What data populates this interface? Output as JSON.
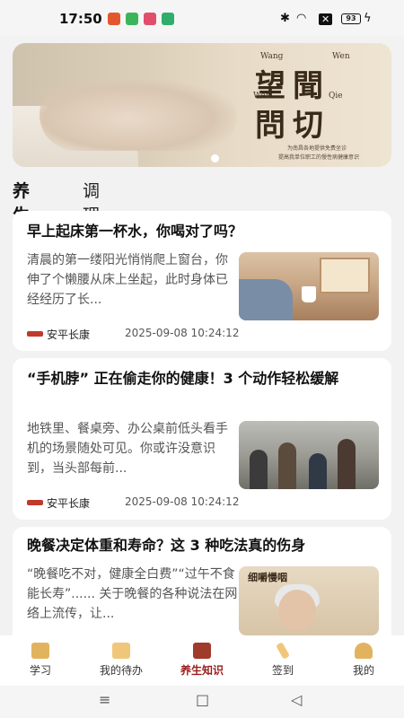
{
  "status_bar": {
    "time": "17:50",
    "battery": "93",
    "icons": [
      "app-red-icon",
      "app-green-icon",
      "app-pink-icon",
      "app-green2-icon",
      "bluetooth-icon",
      "wifi-icon",
      "notification-x-icon",
      "battery-icon",
      "charging-icon"
    ]
  },
  "banner": {
    "big_line1": "望聞",
    "big_line2": "問切",
    "pinyin_wang": "Wang",
    "pinyin_wen1": "Wen",
    "pinyin_wen2": "Wen",
    "pinyin_qie": "Qie",
    "subtitle_line1": "为南昌各地提供免费坐诊",
    "subtitle_line2": "提高我单位职工的慢性病健康意识",
    "page_indicator": "1"
  },
  "category_tabs": {
    "active": "养生",
    "inactive": "调理"
  },
  "articles": [
    {
      "title": "早上起床第一杯水，你喝对了吗？",
      "summary": "清晨的第一缕阳光悄悄爬上窗台，你伸了个懒腰从床上坐起，此时身体已经经历了长...",
      "source": "安平长康",
      "time": "2025-09-08 10:24:12",
      "thumb": "morning-water-image"
    },
    {
      "title": "“手机脖” 正在偷走你的健康！3 个动作轻松缓解",
      "summary": "地铁里、餐桌旁、办公桌前低头看手机的场景随处可见。你或许没意识到，当头部每前...",
      "source": "安平长康",
      "time": "2025-09-08 10:24:12",
      "thumb": "subway-phone-image"
    },
    {
      "title": "晚餐决定体重和寿命？这 3 种吃法真的伤身",
      "summary": "“晚餐吃不对，健康全白费”“过午不食能长寿”...... 关于晚餐的各种说法在网络上流传，让...",
      "thumb_caption": "细嚼慢咽",
      "thumb": "elderly-eating-image"
    }
  ],
  "bottom_nav": [
    {
      "label": "学习",
      "icon": "book-icon"
    },
    {
      "label": "我的待办",
      "icon": "todo-icon"
    },
    {
      "label": "养生知识",
      "icon": "health-book-icon",
      "active": true
    },
    {
      "label": "签到",
      "icon": "pen-icon"
    },
    {
      "label": "我的",
      "icon": "user-icon"
    }
  ],
  "system_nav": {
    "menu": "≡",
    "home": "□",
    "back": "◁"
  },
  "colors": {
    "accent": "#9b1c1c",
    "background": "#f2f2f2",
    "card": "#ffffff"
  }
}
